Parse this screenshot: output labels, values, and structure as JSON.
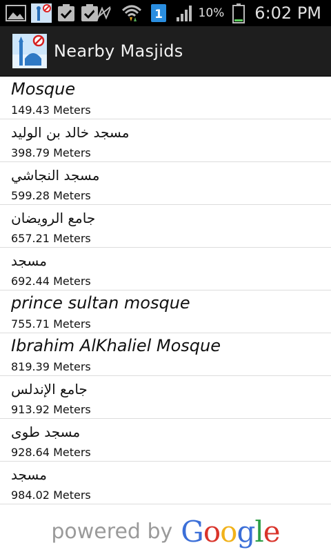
{
  "status_bar": {
    "notification_badge": "1",
    "battery_percent": "10%",
    "time": "6:02 PM",
    "icons": [
      "gallery-icon",
      "app-notification-icon",
      "task-check-icon",
      "task-check-icon",
      "no-signal-icon",
      "wifi-icon",
      "sim-card-icon",
      "signal-icon",
      "battery-icon"
    ]
  },
  "action_bar": {
    "title": "Nearby Masjids",
    "icon": "mosque-icon"
  },
  "mosques": [
    {
      "name": "Mosque",
      "distance": "149.43 Meters",
      "script": "latin"
    },
    {
      "name": "مسجد خالد بن الوليد",
      "distance": "398.79 Meters",
      "script": "arabic"
    },
    {
      "name": "مسجد النجاشي",
      "distance": "599.28 Meters",
      "script": "arabic"
    },
    {
      "name": "جامع الرويضان",
      "distance": "657.21 Meters",
      "script": "arabic"
    },
    {
      "name": "مسجد",
      "distance": "692.44 Meters",
      "script": "arabic"
    },
    {
      "name": "prince sultan mosque",
      "distance": "755.71 Meters",
      "script": "latin"
    },
    {
      "name": "Ibrahim AlKhaliel Mosque",
      "distance": "819.39 Meters",
      "script": "latin"
    },
    {
      "name": "جامع الإندلس",
      "distance": "913.92 Meters",
      "script": "arabic"
    },
    {
      "name": "مسجد طوى",
      "distance": "928.64 Meters",
      "script": "arabic"
    },
    {
      "name": "مسجد",
      "distance": "984.02 Meters",
      "script": "arabic"
    }
  ],
  "footer": {
    "powered_by": "powered by",
    "brand_letters": [
      "G",
      "o",
      "o",
      "g",
      "l",
      "e"
    ],
    "brand_colors": [
      "#3b6fd8",
      "#d9342b",
      "#f1b21a",
      "#3b6fd8",
      "#2f9f48",
      "#d9342b"
    ]
  }
}
